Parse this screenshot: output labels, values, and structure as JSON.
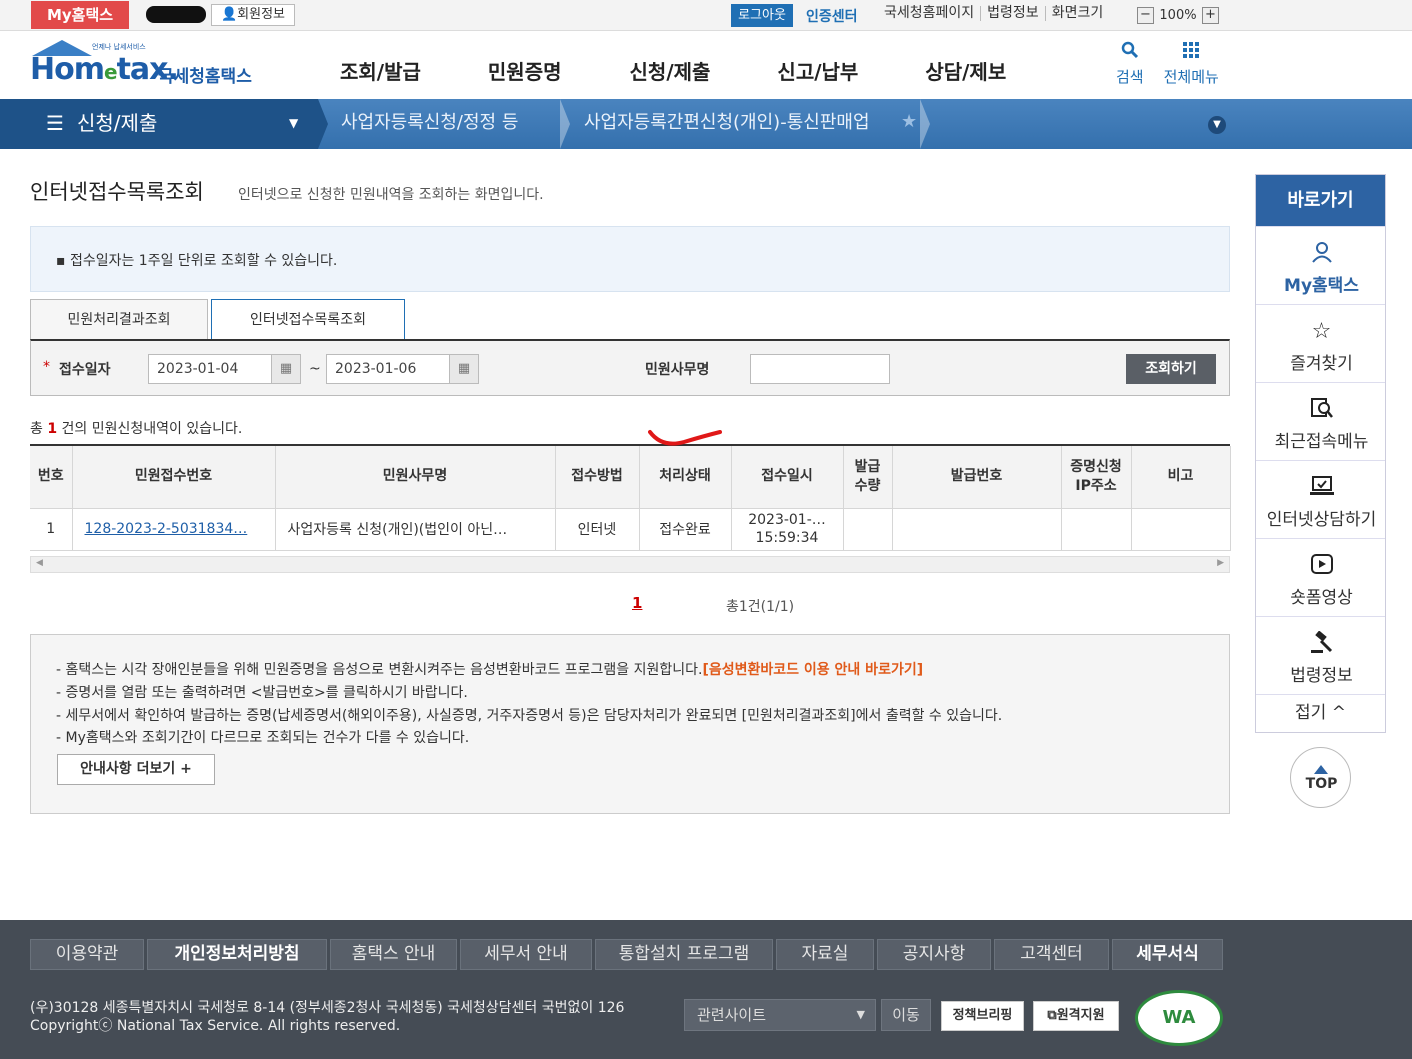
{
  "topbar": {
    "my_hometax": "My홈택스",
    "member_info": "회원정보",
    "logout": "로그아웃",
    "cert_center": "인증센터",
    "links": [
      "국세청홈페이지",
      "법령정보",
      "화면크기"
    ],
    "zoom_minus": "−",
    "zoom_value": "100%",
    "zoom_plus": "+"
  },
  "header": {
    "logo_small": "언제나 납세서비스",
    "logo_main": "Hom",
    "logo_e": "e",
    "logo_rest": "tax.",
    "logo_korean": "국세청홈택스",
    "nav": [
      "조회/발급",
      "민원증명",
      "신청/제출",
      "신고/납부",
      "상담/제보"
    ],
    "search_label": "검색",
    "allmenu_label": "전체메뉴"
  },
  "location": {
    "current": "신청/제출",
    "crumb1": "사업자등록신청/정정 등",
    "crumb2": "사업자등록간편신청(개인)-통신판매업"
  },
  "page": {
    "title": "인터넷접수목록조회",
    "desc": "인터넷으로 신청한 민원내역을 조회하는 화면입니다.",
    "notice": "▪ 접수일자는 1주일 단위로 조회할 수 있습니다."
  },
  "tabs": [
    "민원처리결과조회",
    "인터넷접수목록조회"
  ],
  "search": {
    "required_mark": "*",
    "date_label": "접수일자",
    "date_from": "2023-01-04",
    "date_to": "2023-01-06",
    "tilde": "~",
    "name_label": "민원사무명",
    "name_value": "",
    "query_button": "조회하기"
  },
  "result": {
    "prefix": "총",
    "count": "1",
    "suffix": "건의 민원신청내역이 있습니다."
  },
  "table": {
    "headers": [
      "번호",
      "민원접수번호",
      "민원사무명",
      "접수방법",
      "처리상태",
      "접수일시",
      "발급\n수량",
      "발급번호",
      "증명신청\nIP주소",
      "비고"
    ],
    "rows": [
      [
        "1",
        "128-2023-2-5031834…",
        "사업자등록 신청(개인)(법인이 아닌…",
        "인터넷",
        "접수완료",
        "2023-01-…\n15:59:34",
        "",
        "",
        "",
        ""
      ]
    ]
  },
  "pager": {
    "current": "1",
    "total": "총1건(1/1)"
  },
  "info": {
    "line1": "- 홈택스는 시각 장애인분들을 위해 민원증명을 음성으로 변환시켜주는 음성변환바코드 프로그램을 지원합니다.",
    "line1_link": "[음성변환바코드 이용 안내 바로가기]",
    "line2": "- 증명서를 열람 또는 출력하려면 <발급번호>를 클릭하시기 바랍니다.",
    "line3": "- 세무서에서 확인하여 발급하는 증명(납세증명서(해외이주용), 사실증명, 거주자증명서 등)은 담당자처리가 완료되면 [민원처리결과조회]에서 출력할 수 있습니다.",
    "line4": "- My홈택스와 조회기간이 다르므로 조회되는 건수가 다를 수 있습니다.",
    "more_button": "안내사항 더보기 +"
  },
  "quick": {
    "title": "바로가기",
    "items": [
      "My홈택스",
      "즐겨찾기",
      "최근접속메뉴",
      "인터넷상담하기",
      "숏폼영상",
      "법령정보"
    ],
    "fold": "접기 ^",
    "top": "TOP"
  },
  "footer": {
    "nav": [
      "이용약관",
      "개인정보처리방침",
      "홈택스 안내",
      "세무서 안내",
      "통합설치 프로그램",
      "자료실",
      "공지사항",
      "고객센터",
      "세무서식"
    ],
    "address": "(우)30128 세종특별자치시 국세청로 8-14 (정부세종2청사 국세청동) 국세청상담센터 국번없이 126",
    "copyright": "Copyrightⓒ National Tax Service. All rights reserved.",
    "related_sites": "관련사이트",
    "go": "이동",
    "badge1": "정책브리핑",
    "badge2": "원격지원",
    "wa": "WA"
  },
  "colors": {
    "brand_blue": "#1f6fb4",
    "location_bar": "#3470ad",
    "footer_bg": "#454c55",
    "highlight_red": "#cc0000",
    "info_orange": "#e05a1a"
  }
}
